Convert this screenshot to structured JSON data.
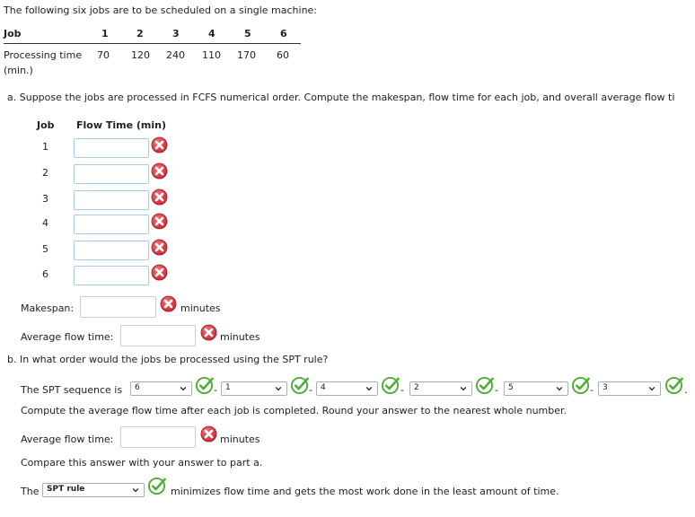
{
  "intro": "The following six jobs are to be scheduled on a single machine:",
  "job_table": {
    "job_header": "Job",
    "job_numbers": [
      "1",
      "2",
      "3",
      "4",
      "5",
      "6"
    ],
    "processing_label_line1": "Processing time",
    "processing_label_line2": "(min.)",
    "processing_times": [
      "70",
      "120",
      "240",
      "110",
      "170",
      "60"
    ]
  },
  "part_a": {
    "question": "a. Suppose the jobs are processed in FCFS numerical order. Compute the makespan, flow time for each job, and overall average flow ti",
    "col_job": "Job",
    "col_flow": "Flow Time (min)",
    "rows": [
      {
        "job": "1",
        "value": ""
      },
      {
        "job": "2",
        "value": ""
      },
      {
        "job": "3",
        "value": ""
      },
      {
        "job": "4",
        "value": ""
      },
      {
        "job": "5",
        "value": ""
      },
      {
        "job": "6",
        "value": ""
      }
    ],
    "makespan_label": "Makespan:",
    "makespan_value": "",
    "makespan_unit": "minutes",
    "avg_label": "Average flow time:",
    "avg_value": "",
    "avg_unit": "minutes"
  },
  "part_b": {
    "question": "b. In what order would the jobs be processed using the SPT rule?",
    "sequence_label": "The SPT sequence is",
    "sequence": [
      "6",
      "1",
      "4",
      "2",
      "5",
      "3"
    ],
    "sequence_end": ".",
    "compute_text": "Compute the average flow time after each job is completed. Round your answer to the nearest whole number.",
    "avg_label": "Average flow time:",
    "avg_value": "",
    "avg_unit": "minutes",
    "compare_text": "Compare this answer with your answer to part a.",
    "the_label": "The",
    "rule_select": "SPT rule",
    "conclusion": "minimizes flow time and gets the most work done in the least amount of time."
  },
  "colors": {
    "incorrect": "#d9363e",
    "correct": "#4caf34"
  },
  "icons": {
    "incorrect": "x-circle-icon",
    "correct": "check-circle-icon",
    "dropdown": "chevron-down-icon"
  }
}
